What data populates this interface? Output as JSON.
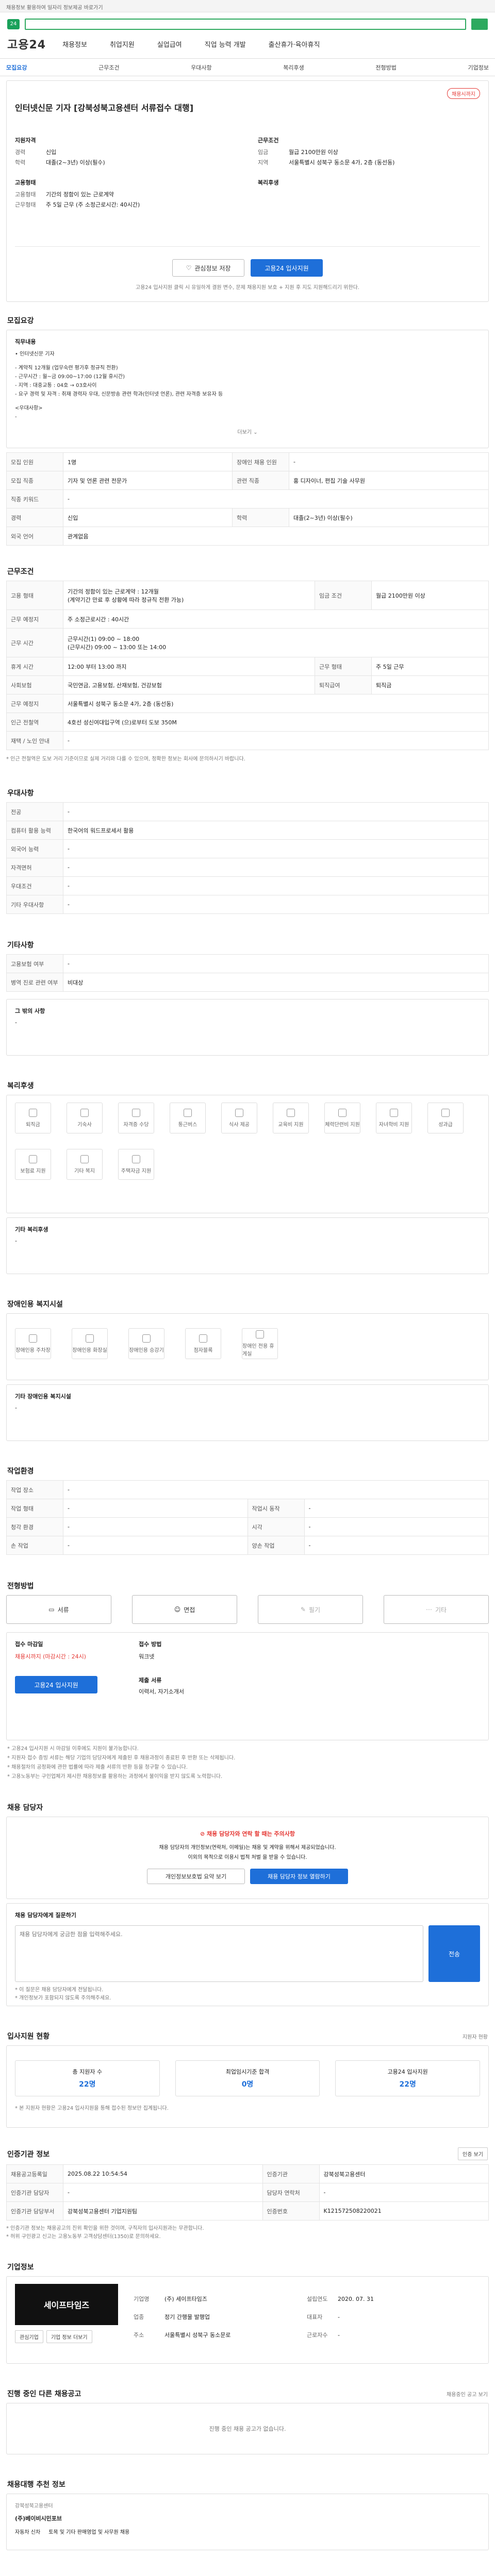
{
  "topbar": {
    "text": "채용정보 활용하여 일자리 정보제공 바로가기"
  },
  "header": {
    "brand": "고용24",
    "nav": [
      "채용정보",
      "취업지원",
      "실업급여",
      "직업 능력 개발",
      "출산휴가·육아휴직"
    ],
    "tabs": [
      "모집요강",
      "근무조건",
      "우대사항",
      "복리후생",
      "전형방법",
      "기업정보"
    ]
  },
  "summary": {
    "badge": "채용시까지",
    "title": "인터넷신문 기자 [강북성북고용센터 서류접수 대행]",
    "left_group1_label": "지원자격",
    "left_group1": [
      {
        "k": "경력",
        "v": "신입"
      },
      {
        "k": "학력",
        "v": "대졸(2~3년) 이상(필수)"
      }
    ],
    "right_group1_label": "근무조건",
    "right_group1": [
      {
        "k": "임금",
        "v": "월급 2100만원 이상"
      },
      {
        "k": "지역",
        "v": "서울특별시 성북구 동소문 4가, 2층 (동선동)"
      }
    ],
    "left_group2_label": "고용형태",
    "left_group2": [
      {
        "k": "고용형태",
        "v": "기간의 정함이 있는 근로계약"
      },
      {
        "k": "근무형태",
        "v": "주 5일 근무 (주 소정근로시간: 40시간)"
      }
    ],
    "right_group2_label": "복리후생",
    "scrap_label": "관심정보 저장",
    "apply_label": "고용24 입사지원",
    "apply_note": "고용24 입사지원 클릭 시 유일하게 결원 변수, 문제 채용지원 보호 + 지원 후 지도 지원해드리기 위한다."
  },
  "recruit": {
    "section_title": "모집요강",
    "box_title": "직무내용",
    "box_lines": [
      "• 인터넷신문 기자",
      "",
      "- 계약직 12개월 (업무숙련 평가후 정규직 전환)",
      "- 근무시간 : 월~금 09:00~17:00 (12월 휴시간)",
      "- 지역 : 대중교통 : 04호 → 03호사이",
      "- 요구 경력 및 자격 : 취재 경력자 우대, 신문방송 관련 학과(인터넷 언론), 관련 자격증 보유자 등",
      "",
      "<우대사항>",
      "-"
    ],
    "more_label": "더보기",
    "table": [
      [
        "모집 인원",
        "1명",
        "장애인 채용 인원",
        "-"
      ],
      [
        "모집 직종",
        "기자 및 언론 관련 전문가",
        "관련 직종",
        "홍 디자이너, 편집 기술 사무원"
      ],
      [
        "직종 키워드",
        "-",
        "",
        ""
      ],
      [
        "경력",
        "신입",
        "학력",
        "대졸(2~3년) 이상(필수)"
      ],
      [
        "외국 언어",
        "관계없음",
        "",
        ""
      ]
    ]
  },
  "work": {
    "section_title": "근무조건",
    "table": [
      [
        "고용 형태",
        "기간의 정함이 있는 근로계약 : 12개월\n(계약기간 만료 후 상황에 따라 정규직 전환 가능)",
        "임금 조건",
        "월급 2100만원 이상"
      ],
      [
        "근무 예정지",
        "주 소정근로시간 : 40시간",
        "",
        ""
      ],
      [
        "근무 시간",
        "근무시간(1) 09:00 ~ 18:00\n(근무시간) 09:00 ~ 13:00 또는 14:00",
        "",
        ""
      ],
      [
        "휴게 시간",
        "12:00 부터 13:00 까지",
        "근무 형태",
        "주 5일 근무"
      ],
      [
        "사회보험",
        "국민연금, 고용보험, 산재보험, 건강보험",
        "퇴직급여",
        "퇴직금"
      ],
      [
        "근무 예정지",
        "서울특별시 성북구 동소문 4가, 2층 (동선동)",
        "",
        ""
      ],
      [
        "인근 전철역",
        "4호선 성신여대입구역 (으)로부터 도보 350M",
        "",
        ""
      ],
      [
        "재택 / 노인 안내",
        "-",
        "",
        ""
      ]
    ],
    "note": "* 인근 전철역은 도보 거리 기준이므로 실제 거리와 다를 수 있으며, 정확한 정보는 회사에 문의하시기 바랍니다."
  },
  "prefer": {
    "section_title": "우대사항",
    "table": [
      [
        "전공",
        "-"
      ],
      [
        "컴퓨터 활용 능력",
        "한국어의 워드프로세서 활용"
      ],
      [
        "외국어 능력",
        "-"
      ],
      [
        "자격면허",
        "-"
      ],
      [
        "우대조건",
        "-"
      ],
      [
        "기타 우대사항",
        "-"
      ]
    ]
  },
  "etc": {
    "section_title": "기타사항",
    "table": [
      [
        "고용보험 여부",
        "-"
      ],
      [
        "병역 진로 관련 여부",
        "비대상"
      ]
    ],
    "box_title": "그 밖의 사항",
    "box_text": "-"
  },
  "welfare": {
    "section_title": "복리후생",
    "icons": [
      "퇴직금",
      "기숙사",
      "자격증 수당",
      "통근버스",
      "식사 제공",
      "교육비 지원",
      "체력단련비 지원",
      "자녀학비 지원",
      "성과급",
      "보험료 지원",
      "기타 복지",
      "주택자금 지원"
    ],
    "box_title": "기타 복리후생",
    "box_text": "-"
  },
  "disabled": {
    "section_title": "장애인용 복지시설",
    "icons": [
      "장애인용 주차장",
      "장애인용 화장실",
      "장애인용 승강기",
      "점자블록",
      "장애인 전용 휴게실"
    ],
    "box_title": "기타 장애인용 복지시설",
    "box_text": "-"
  },
  "env": {
    "section_title": "작업환경",
    "table": [
      [
        "작업 장소",
        "-",
        "",
        ""
      ],
      [
        "작업 형태",
        "-",
        "작업시 동작",
        "-"
      ],
      [
        "청각 환경",
        "-",
        "시각",
        "-"
      ],
      [
        "손 작업",
        "-",
        "양손 작업",
        "-"
      ]
    ]
  },
  "method": {
    "section_title": "전형방법",
    "steps": [
      "서류",
      "면접",
      "필기",
      "기타"
    ],
    "apply_left_title": "접수 마감일",
    "apply_left_value": "채용시까지 (마감시간 : 24시)",
    "apply_right_title": "접수 방법",
    "apply_right_value": "워크넷",
    "apply_btn": "고용24 입사지원",
    "docs_title": "제출 서류",
    "docs_value": "이력서, 자기소개서",
    "notes": [
      "* 고용24 입사지원 시 마감일 이후에도 지원이 불가능합니다.",
      "* 지원자 접수 증빙 서류는 해당 기업의 담당자에게 제출된 후 채용과정이 종료된 후 반환 또는 삭제됩니다.",
      "* 채용절차의 공정화에 관한 법률에 따라 제출 서류의 반환 등을 청구할 수 있습니다.",
      "* 고용노동부는 구인업체가 제시한 채용정보를 활용하는 과정에서 불이익을 받지 않도록 노력합니다."
    ]
  },
  "contact": {
    "section_title": "채용 담당자",
    "warn_title": "채용 담당자와 연락 할 때는 주의사항",
    "warn_text": "채용 담당자의 개인정보(연락처, 이메일)는 채용 및 계약을 위해서 제공되었습니다.",
    "warn_text2": "이외의 목적으로 이용시 법적 처벌 을 받을 수 있습니다.",
    "btn1": "개인정보보호법 요약 보기",
    "btn2": "채용 담당자 정보 열람하기",
    "inquiry_title": "채용 담당자에게 질문하기",
    "inquiry_placeholder": "채용 담당자에게 궁금한 점을 입력해주세요.",
    "inquiry_btn": "전송",
    "inquiry_notes": [
      "* 이 질문은 채용 담당자에게 전달됩니다.",
      "* 개인정보가 포함되지 않도록 주의해주세요."
    ]
  },
  "stats": {
    "section_title": "입사지원 현황",
    "link": "지원자 현황",
    "items": [
      {
        "label": "총 지원자 수",
        "value": "22명"
      },
      {
        "label": "최업임시기준 합격",
        "value": "0명"
      },
      {
        "label": "고용24 입사지원",
        "value": "22명"
      }
    ],
    "note": "* 본 지원자 현황은 고용24 입사지원을 통해 접수된 정보만 집계됩니다."
  },
  "info": {
    "section_title": "인증기관 정보",
    "link_btn": "인증 보기",
    "table": [
      [
        "채용공고등록일",
        "2025.08.22 10:54:54",
        "인증기관",
        "강북성북고용센터"
      ],
      [
        "인증기관 담당자",
        "-",
        "담당자 연락처",
        "-"
      ],
      [
        "인증기관 담당부서",
        "강북성북고용센터 기업지원팀",
        "인증번호",
        "K121572508220021"
      ]
    ],
    "notes": [
      "* 인증기관 정보는 채용공고의 진위 확인을 위한 것이며, 구직자의 입사지원과는 무관합니다.",
      "* 허위 구인광고 신고는 고용노동부 고객상담센터(1350)로 문의하세요."
    ]
  },
  "company": {
    "section_title": "기업정보",
    "logo_text": "세이프타임즈",
    "fields": [
      {
        "k": "기업명",
        "v": "(주) 세이프타임즈"
      },
      {
        "k": "업종",
        "v": "정기 간행물 발행업"
      },
      {
        "k": "대표자",
        "v": "-"
      },
      {
        "k": "설립연도",
        "v": "2020. 07. 31"
      },
      {
        "k": "주소",
        "v": "서울특별시 성북구 동소문로"
      },
      {
        "k": "근로자수",
        "v": "-"
      }
    ],
    "btn1": "관심기업",
    "btn2": "기업 정보 더보기"
  },
  "other": {
    "section_title": "진행 중인 다른 채용공고",
    "link": "채용중인 공고 보기",
    "empty": "진행 중인 채용 공고가 없습니다."
  },
  "recent": {
    "section_title": "채용대행 추천 정보",
    "box_title": "강북성북고용센터",
    "company": "(주)베이비시민포브",
    "items": [
      "자동차 신차",
      "토목 및 기타 판매영업 및 사무원 채용"
    ]
  }
}
